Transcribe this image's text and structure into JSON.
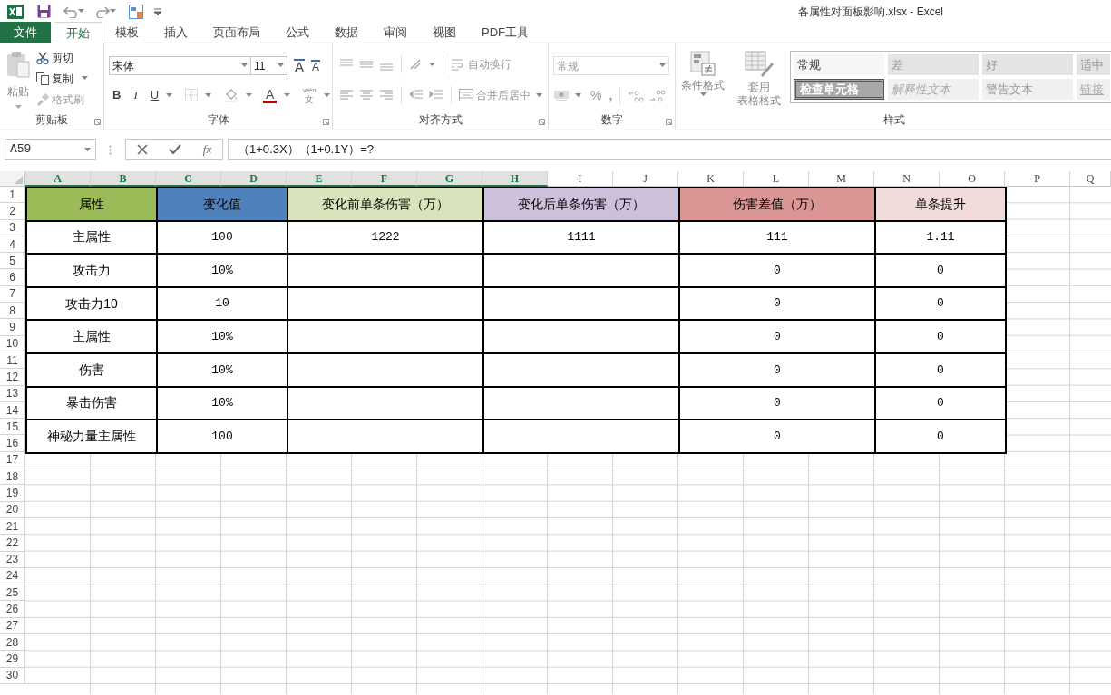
{
  "window": {
    "title": "各属性对面板影响.xlsx - Excel"
  },
  "tabs": [
    {
      "label": "文件",
      "kind": "file",
      "selected": false
    },
    {
      "label": "开始",
      "kind": "tab",
      "selected": true
    },
    {
      "label": "模板",
      "kind": "tab",
      "selected": false
    },
    {
      "label": "插入",
      "kind": "tab",
      "selected": false
    },
    {
      "label": "页面布局",
      "kind": "tab",
      "selected": false
    },
    {
      "label": "公式",
      "kind": "tab",
      "selected": false
    },
    {
      "label": "数据",
      "kind": "tab",
      "selected": false
    },
    {
      "label": "审阅",
      "kind": "tab",
      "selected": false
    },
    {
      "label": "视图",
      "kind": "tab",
      "selected": false
    },
    {
      "label": "PDF工具",
      "kind": "tab",
      "selected": false
    }
  ],
  "ribbon": {
    "clipboard": {
      "paste": "粘贴",
      "cut": "剪切",
      "copy": "复制",
      "format_painter": "格式刷",
      "label": "剪贴板"
    },
    "font": {
      "font_name": "宋体",
      "font_size": "11",
      "grow": "A",
      "shrink": "A",
      "bold": "B",
      "italic": "I",
      "underline": "U",
      "font_color": "A",
      "phonetic_top": "wén",
      "phonetic_bottom": "文",
      "label": "字体"
    },
    "alignment": {
      "wrap_text": "自动换行",
      "merge_center": "合并后居中",
      "label": "对齐方式"
    },
    "number": {
      "format": "常规",
      "percent": "%",
      "comma": ",",
      "label": "数字"
    },
    "styles": {
      "conditional_format": "条件格式",
      "format_as_table": [
        "套用",
        "表格格式"
      ],
      "gallery": [
        {
          "label": "常规",
          "kind": "normal"
        },
        {
          "label": "差",
          "kind": "bad"
        },
        {
          "label": "好",
          "kind": "good"
        },
        {
          "label": "适中",
          "kind": "neutral"
        },
        {
          "label": "检查单元格",
          "kind": "check"
        },
        {
          "label": "解释性文本",
          "kind": "explanatory"
        },
        {
          "label": "警告文本",
          "kind": "warning"
        },
        {
          "label": "链接",
          "kind": "link"
        }
      ],
      "label": "样式"
    }
  },
  "formula_bar": {
    "name_box": "A59",
    "function_label": "fx",
    "formula": "（1+0.3X）（1+0.1Y）=?"
  },
  "sheet": {
    "columns": [
      {
        "label": "A",
        "selected": true
      },
      {
        "label": "B",
        "selected": true
      },
      {
        "label": "C",
        "selected": true
      },
      {
        "label": "D",
        "selected": true
      },
      {
        "label": "E",
        "selected": true
      },
      {
        "label": "F",
        "selected": true
      },
      {
        "label": "G",
        "selected": true
      },
      {
        "label": "H",
        "selected": true
      },
      {
        "label": "I",
        "selected": false
      },
      {
        "label": "J",
        "selected": false
      },
      {
        "label": "K",
        "selected": false
      },
      {
        "label": "L",
        "selected": false
      },
      {
        "label": "M",
        "selected": false
      },
      {
        "label": "N",
        "selected": false
      },
      {
        "label": "O",
        "selected": false
      },
      {
        "label": "P",
        "selected": false
      },
      {
        "label": "Q",
        "selected": false
      }
    ],
    "rows": [
      "1",
      "2",
      "3",
      "4",
      "5",
      "6",
      "7",
      "8",
      "9",
      "10",
      "11",
      "12",
      "13",
      "14",
      "15",
      "16",
      "17",
      "18",
      "19",
      "20",
      "21",
      "22",
      "23",
      "24",
      "25",
      "26",
      "27",
      "28",
      "29",
      "30"
    ],
    "table": {
      "header": [
        {
          "label": "属性",
          "color": "#9bbb59"
        },
        {
          "label": "变化值",
          "color": "#4f81bd"
        },
        {
          "label": "变化前单条伤害（万）",
          "color": "#d8e4bc"
        },
        {
          "label": "变化后单条伤害（万）",
          "color": "#ccc0da"
        },
        {
          "label": "伤害差值（万）",
          "color": "#da9694"
        },
        {
          "label": "单条提升",
          "color": "#f2dcdb"
        }
      ],
      "rows": [
        [
          "主属性",
          "100",
          "1222",
          "1111",
          "111",
          "1.11"
        ],
        [
          "攻击力",
          "10%",
          null,
          null,
          "0",
          "0"
        ],
        [
          "攻击力10",
          "10",
          null,
          null,
          "0",
          "0"
        ],
        [
          "主属性",
          "10%",
          null,
          null,
          "0",
          "0"
        ],
        [
          "伤害",
          "10%",
          null,
          null,
          "0",
          "0"
        ],
        [
          "暴击伤害",
          "10%",
          null,
          null,
          "0",
          "0"
        ],
        [
          "神秘力量主属性",
          "100",
          null,
          null,
          "0",
          "0"
        ]
      ]
    }
  }
}
